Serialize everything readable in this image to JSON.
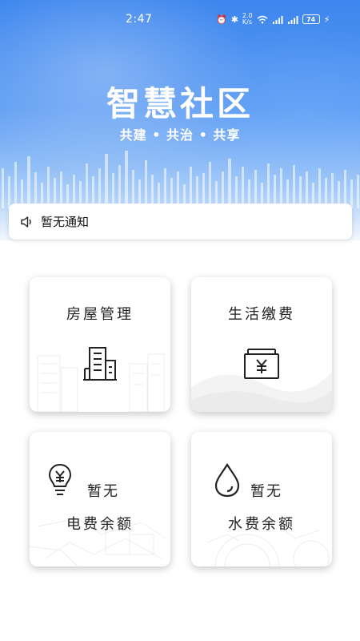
{
  "status_bar": {
    "time": "2:47",
    "battery": "74",
    "icons": [
      "alarm-icon",
      "bluetooth-icon",
      "data-icon",
      "wifi-icon",
      "signal-icon",
      "signal-icon",
      "charging-icon"
    ]
  },
  "header": {
    "title": "智慧社区",
    "subtitle": "共建 • 共治 • 共享"
  },
  "notice": {
    "icon": "speaker-icon",
    "text": "暂无通知"
  },
  "cards": {
    "house": {
      "label": "房屋管理",
      "icon": "building-icon"
    },
    "payment": {
      "label": "生活缴费",
      "icon": "yuan-box-icon"
    },
    "electricity": {
      "value": "暂无",
      "label": "电费余额",
      "icon": "lightbulb-yuan-icon"
    },
    "water": {
      "value": "暂无",
      "label": "水费余额",
      "icon": "water-drop-icon"
    }
  },
  "colors": {
    "hero_top": "#3d86ee",
    "hero_bottom": "#a9cdf8",
    "text": "#222222"
  }
}
